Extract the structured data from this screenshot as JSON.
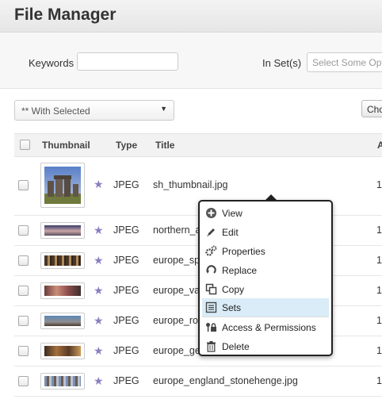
{
  "header": {
    "title": "File Manager"
  },
  "search": {
    "keywords_label": "Keywords",
    "keywords_value": "",
    "sets_label": "In Set(s)",
    "sets_placeholder": "Select Some Options"
  },
  "toolbar": {
    "bulk_action": "** With Selected",
    "choose_label": "Choose"
  },
  "table": {
    "columns": [
      "Thumbnail",
      "Type",
      "Title",
      "A"
    ],
    "rows": [
      {
        "type": "JPEG",
        "title": "sh_thumbnail.jpg",
        "extra": "1"
      },
      {
        "type": "JPEG",
        "title": "northern_a",
        "extra": "1"
      },
      {
        "type": "JPEG",
        "title": "europe_spa",
        "extra": "1"
      },
      {
        "type": "JPEG",
        "title": "europe_val",
        "extra": "1"
      },
      {
        "type": "JPEG",
        "title": "europe_rot",
        "extra": "1"
      },
      {
        "type": "JPEG",
        "title": "europe_ger",
        "extra": "1"
      },
      {
        "type": "JPEG",
        "title": "europe_england_stonehenge.jpg",
        "extra": "1"
      }
    ]
  },
  "context_menu": {
    "items": [
      {
        "label": "View",
        "icon": "plus-circle-icon"
      },
      {
        "label": "Edit",
        "icon": "pencil-icon"
      },
      {
        "label": "Properties",
        "icon": "gears-icon"
      },
      {
        "label": "Replace",
        "icon": "refresh-icon"
      },
      {
        "label": "Copy",
        "icon": "copy-icon"
      },
      {
        "label": "Sets",
        "icon": "list-icon",
        "highlighted": true
      },
      {
        "label": "Access & Permissions",
        "icon": "key-lock-icon"
      },
      {
        "label": "Delete",
        "icon": "trash-icon"
      }
    ]
  },
  "colors": {
    "highlight": "#d9ecf7",
    "star": "#8a7fc2"
  }
}
